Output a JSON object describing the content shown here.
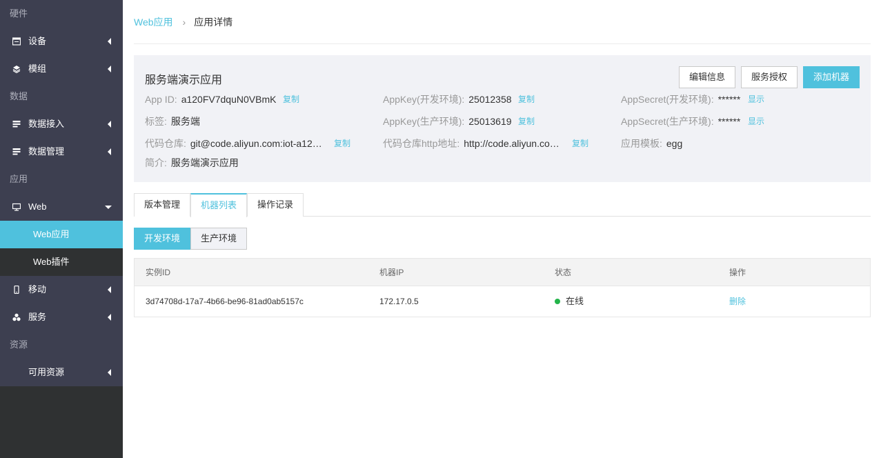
{
  "sidebar": {
    "groups": {
      "hardware": "硬件",
      "data": "数据",
      "app": "应用",
      "resource": "资源"
    },
    "items": {
      "device": "设备",
      "module": "模组",
      "data_access": "数据接入",
      "data_manage": "数据管理",
      "web": "Web",
      "web_app": "Web应用",
      "web_plugin": "Web插件",
      "mobile": "移动",
      "service": "服务",
      "available_resource": "可用资源"
    }
  },
  "breadcrumb": {
    "parent": "Web应用",
    "separator": "›",
    "current": "应用详情"
  },
  "app": {
    "name": "服务端演示应用",
    "buttons": {
      "edit": "编辑信息",
      "authorize": "服务授权",
      "add_machine": "添加机器"
    },
    "fields": {
      "app_id": {
        "label": "App ID:",
        "value": "a120FV7dquN0VBmK",
        "action": "复制"
      },
      "appkey_dev": {
        "label": "AppKey(开发环境):",
        "value": "25012358",
        "action": "复制"
      },
      "appsecret_dev": {
        "label": "AppSecret(开发环境):",
        "value": "******",
        "action": "显示"
      },
      "tag": {
        "label": "标签:",
        "value": "服务端"
      },
      "appkey_prod": {
        "label": "AppKey(生产环境):",
        "value": "25013619",
        "action": "复制"
      },
      "appsecret_prod": {
        "label": "AppSecret(生产环境):",
        "value": "******",
        "action": "显示"
      },
      "repo": {
        "label": "代码仓库:",
        "value": "git@code.aliyun.com:iot-a12…",
        "action": "复制"
      },
      "repo_http": {
        "label": "代码仓库http地址:",
        "value": "http://code.aliyun.co…",
        "action": "复制"
      },
      "template": {
        "label": "应用模板:",
        "value": "egg"
      },
      "desc": {
        "label": "简介:",
        "value": "服务端演示应用"
      }
    }
  },
  "tabs": [
    "版本管理",
    "机器列表",
    "操作记录"
  ],
  "active_tab": "机器列表",
  "env": {
    "dev": "开发环境",
    "prod": "生产环境",
    "active": "开发环境"
  },
  "table": {
    "columns": [
      "实例ID",
      "机器IP",
      "状态",
      "操作"
    ],
    "rows": [
      {
        "instance_id": "3d74708d-17a7-4b66-be96-81ad0ab5157c",
        "ip": "172.17.0.5",
        "status": "在线",
        "action": "删除"
      }
    ]
  },
  "colors": {
    "accent": "#4fc1dd",
    "sidebar_bg": "#3d3f50",
    "online": "#23b44a"
  }
}
